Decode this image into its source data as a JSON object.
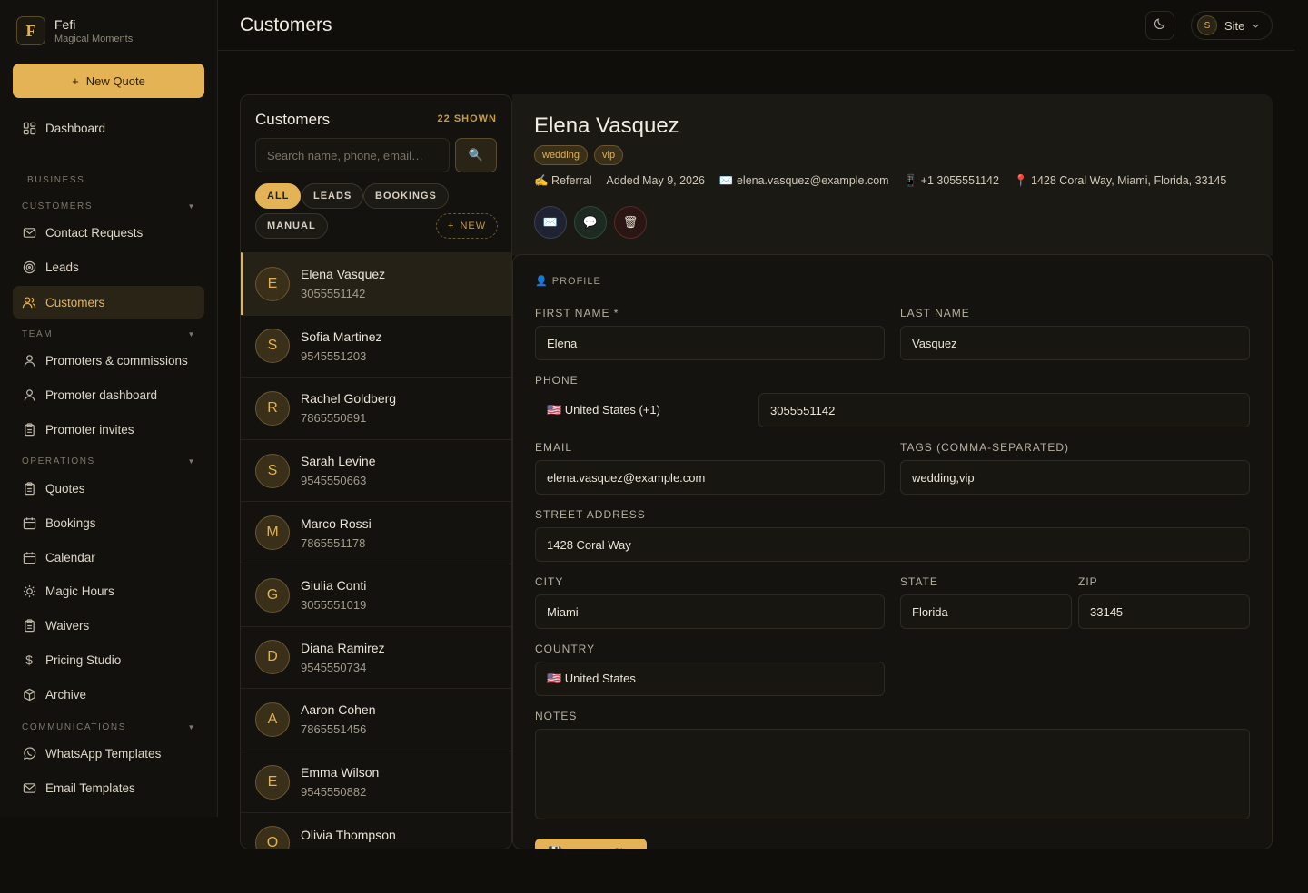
{
  "brand": {
    "logo": "F",
    "name": "Fefi",
    "subtitle": "Magical Moments"
  },
  "sidebar": {
    "new_quote": "New Quote",
    "dashboard": "Dashboard",
    "business": "BUSINESS",
    "sections": {
      "customers": "CUSTOMERS",
      "team": "TEAM",
      "operations": "OPERATIONS",
      "communications": "COMMUNICATIONS"
    },
    "items": {
      "contact_requests": "Contact Requests",
      "leads": "Leads",
      "customers": "Customers",
      "promoters": "Promoters & commissions",
      "promoter_dashboard": "Promoter dashboard",
      "promoter_invites": "Promoter invites",
      "quotes": "Quotes",
      "bookings": "Bookings",
      "calendar": "Calendar",
      "magic_hours": "Magic Hours",
      "waivers": "Waivers",
      "pricing_studio": "Pricing Studio",
      "archive": "Archive",
      "whatsapp": "WhatsApp Templates",
      "email": "Email Templates"
    }
  },
  "header": {
    "title": "Customers",
    "site_avatar": "S",
    "site_label": "Site"
  },
  "list": {
    "title": "Customers",
    "count": "22 SHOWN",
    "search_placeholder": "Search name, phone, email…",
    "filters": {
      "all": "ALL",
      "leads": "LEADS",
      "bookings": "BOOKINGS",
      "manual": "MANUAL",
      "new": "NEW"
    },
    "customers": [
      {
        "initial": "E",
        "name": "Elena Vasquez",
        "phone": "3055551142"
      },
      {
        "initial": "S",
        "name": "Sofia Martinez",
        "phone": "9545551203"
      },
      {
        "initial": "R",
        "name": "Rachel Goldberg",
        "phone": "7865550891"
      },
      {
        "initial": "S",
        "name": "Sarah Levine",
        "phone": "9545550663"
      },
      {
        "initial": "M",
        "name": "Marco Rossi",
        "phone": "7865551178"
      },
      {
        "initial": "G",
        "name": "Giulia Conti",
        "phone": "3055551019"
      },
      {
        "initial": "D",
        "name": "Diana Ramirez",
        "phone": "9545550734"
      },
      {
        "initial": "A",
        "name": "Aaron Cohen",
        "phone": "7865551456"
      },
      {
        "initial": "E",
        "name": "Emma Wilson",
        "phone": "9545550882"
      },
      {
        "initial": "O",
        "name": "Olivia Thompson",
        "phone": ""
      }
    ]
  },
  "detail": {
    "name": "Elena Vasquez",
    "tags": [
      "wedding",
      "vip"
    ],
    "source": "✍️ Referral",
    "added": "Added May 9, 2026",
    "email": "✉️ elena.vasquez@example.com",
    "phone": "📱 +1 3055551142",
    "address": "📍 1428 Coral Way, Miami, Florida, 33145"
  },
  "form": {
    "section": "👤 PROFILE",
    "labels": {
      "first": "FIRST NAME *",
      "last": "LAST NAME",
      "phone": "PHONE",
      "email": "EMAIL",
      "tags": "TAGS (COMMA-SEPARATED)",
      "street": "STREET ADDRESS",
      "city": "CITY",
      "state": "STATE",
      "zip": "ZIP",
      "country": "COUNTRY",
      "notes": "NOTES"
    },
    "values": {
      "first": "Elena",
      "last": "Vasquez",
      "phone_country": "🇺🇸 United States (+1)",
      "phone": "3055551142",
      "email": "elena.vasquez@example.com",
      "tags": "wedding,vip",
      "street": "1428 Coral Way",
      "city": "Miami",
      "state": "Florida",
      "zip": "33145",
      "country": "🇺🇸 United States",
      "notes": ""
    },
    "save": "💾 Save Profile"
  },
  "colors": {
    "accent": "#e4b356",
    "background": "#0f0e0b"
  }
}
